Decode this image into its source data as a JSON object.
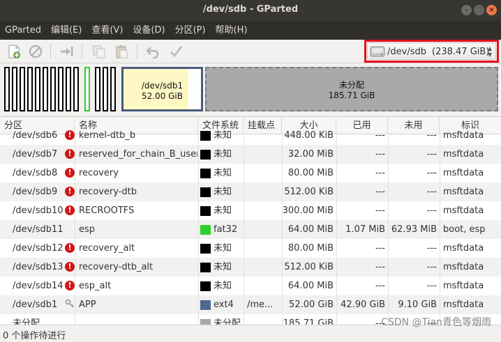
{
  "window": {
    "title": "/dev/sdb - GParted"
  },
  "menu": [
    "GParted",
    "编辑(E)",
    "查看(V)",
    "设备(D)",
    "分区(P)",
    "帮助(H)"
  ],
  "device": {
    "name": "/dev/sdb",
    "size": "(238.47 GiB)"
  },
  "diskmap": {
    "sdb1": {
      "name": "/dev/sdb1",
      "size": "52.00 GiB"
    },
    "unallocated": {
      "name": "未分配",
      "size": "185.71 GiB"
    }
  },
  "table": {
    "columns": [
      "分区",
      "名称",
      "文件系统",
      "挂载点",
      "大小",
      "已用",
      "未用",
      "标识"
    ],
    "rows": [
      {
        "partition": "/dev/sdb6",
        "icon": "error",
        "name": "kernel-dtb_b",
        "fs_color": "#000000",
        "fs": "未知",
        "mount": "",
        "size": "448.00 KiB",
        "used": "---",
        "unused": "---",
        "flags": "msftdata"
      },
      {
        "partition": "/dev/sdb7",
        "icon": "error",
        "name": "reserved_for_chain_B_user",
        "fs_color": "#000000",
        "fs": "未知",
        "mount": "",
        "size": "32.00 MiB",
        "used": "---",
        "unused": "---",
        "flags": "msftdata"
      },
      {
        "partition": "/dev/sdb8",
        "icon": "error",
        "name": "recovery",
        "fs_color": "#000000",
        "fs": "未知",
        "mount": "",
        "size": "80.00 MiB",
        "used": "---",
        "unused": "---",
        "flags": "msftdata"
      },
      {
        "partition": "/dev/sdb9",
        "icon": "error",
        "name": "recovery-dtb",
        "fs_color": "#000000",
        "fs": "未知",
        "mount": "",
        "size": "512.00 KiB",
        "used": "---",
        "unused": "---",
        "flags": "msftdata"
      },
      {
        "partition": "/dev/sdb10",
        "icon": "error",
        "name": "RECROOTFS",
        "fs_color": "#000000",
        "fs": "未知",
        "mount": "",
        "size": "300.00 MiB",
        "used": "---",
        "unused": "---",
        "flags": "msftdata"
      },
      {
        "partition": "/dev/sdb11",
        "icon": "none",
        "name": "esp",
        "fs_color": "#2cd02c",
        "fs": "fat32",
        "mount": "",
        "size": "64.00 MiB",
        "used": "1.07 MiB",
        "unused": "62.93 MiB",
        "flags": "boot, esp"
      },
      {
        "partition": "/dev/sdb12",
        "icon": "error",
        "name": "recovery_alt",
        "fs_color": "#000000",
        "fs": "未知",
        "mount": "",
        "size": "80.00 MiB",
        "used": "---",
        "unused": "---",
        "flags": "msftdata"
      },
      {
        "partition": "/dev/sdb13",
        "icon": "error",
        "name": "recovery-dtb_alt",
        "fs_color": "#000000",
        "fs": "未知",
        "mount": "",
        "size": "512.00 KiB",
        "used": "---",
        "unused": "---",
        "flags": "msftdata"
      },
      {
        "partition": "/dev/sdb14",
        "icon": "error",
        "name": "esp_alt",
        "fs_color": "#000000",
        "fs": "未知",
        "mount": "",
        "size": "64.00 MiB",
        "used": "---",
        "unused": "---",
        "flags": "msftdata"
      },
      {
        "partition": "/dev/sdb1",
        "icon": "key",
        "name": "APP",
        "fs_color": "#4c6a8c",
        "fs": "ext4",
        "mount": "/me...",
        "size": "52.00 GiB",
        "used": "42.90 GiB",
        "unused": "9.10 GiB",
        "flags": "msftdata"
      },
      {
        "partition": "未分配",
        "icon": "none",
        "name": "",
        "fs_color": "#a8a8a8",
        "fs": "未分配",
        "mount": "",
        "size": "185.71 GiB",
        "used": "---",
        "unused": "---",
        "flags": ""
      }
    ]
  },
  "status": {
    "text": "0 个操作待进行"
  },
  "watermark": "CSDN @Tian青色等烟雨"
}
